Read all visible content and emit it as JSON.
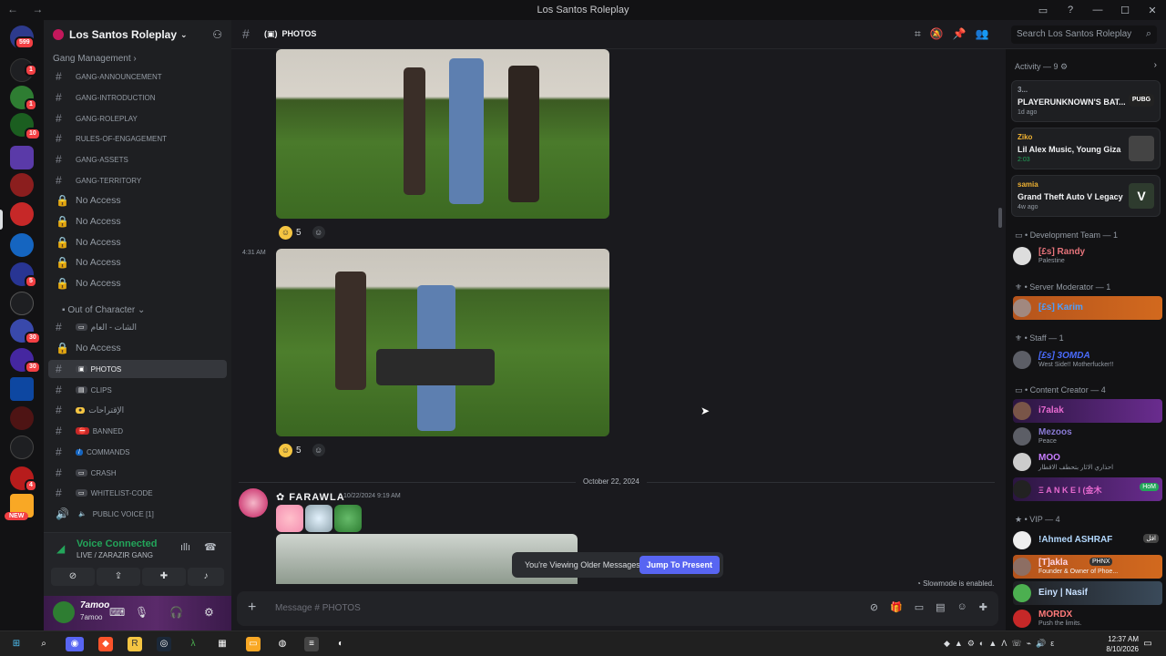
{
  "window": {
    "title": "Los Santos Roleplay",
    "nav": "← →"
  },
  "servers": {
    "badges": [
      "599",
      "1",
      "1",
      "10",
      "5",
      "30",
      "30",
      "4"
    ],
    "new_label": "NEW"
  },
  "guild": {
    "name": "Los Santos Roleplay"
  },
  "channels": {
    "category1": "Gang Management",
    "items": [
      {
        "label": "GANG-ANNOUNCEMENT"
      },
      {
        "label": "GANG-INTRODUCTION"
      },
      {
        "label": "GANG-ROLEPLAY"
      },
      {
        "label": "RULES-OF-ENGAGEMENT"
      },
      {
        "label": "GANG-ASSETS"
      },
      {
        "label": "GANG-TERRITORY"
      },
      {
        "label": "No Access"
      },
      {
        "label": "No Access"
      },
      {
        "label": "No Access"
      },
      {
        "label": "No Access"
      },
      {
        "label": "No Access"
      }
    ],
    "category2": "Out of Character",
    "ooc": [
      {
        "label": "الشات - العام"
      },
      {
        "label": "No Access"
      },
      {
        "label": "PHOTOS"
      },
      {
        "label": "CLIPS"
      },
      {
        "label": "الإقتراحات"
      },
      {
        "label": "BANNED"
      },
      {
        "label": "COMMANDS"
      },
      {
        "label": "CRASH"
      },
      {
        "label": "WHITELIST-CODE"
      },
      {
        "label": "PUBLIC VOICE [1]"
      }
    ]
  },
  "voice": {
    "title": "Voice Connected",
    "subtitle": "LIVE / ZARAZIR GANG"
  },
  "user": {
    "name": "7amoo",
    "status": "7amoo"
  },
  "header": {
    "channel": "PHOTOS",
    "search_placeholder": "Search Los Santos Roleplay"
  },
  "messages": {
    "timestamp": "4:31 AM",
    "reaction_count_1": "5",
    "reaction_count_2": "5",
    "divider_date": "October 22, 2024",
    "author": "FARAWLA",
    "author_time": "10/22/2024 9:19 AM"
  },
  "banner": {
    "text": "You're Viewing Older Messages",
    "button": "Jump To Present"
  },
  "slowmode": "Slowmode is enabled.",
  "composer": {
    "placeholder": "Message #  PHOTOS"
  },
  "activity": {
    "header": "Activity — 9",
    "cards": [
      {
        "user": "3...",
        "title": "PLAYERUNKNOWN'S BAT...",
        "sub": "1d ago",
        "art": "PUBG"
      },
      {
        "user": "Ziko",
        "title": "Lil Alex Music, Young Giza",
        "sub": "2:03",
        "art": ""
      },
      {
        "user": "samia",
        "title": "Grand Theft Auto V Legacy",
        "sub": "4w ago",
        "art": "V"
      }
    ],
    "roles": {
      "dev": "Development Team — 1",
      "mod": "Server Moderator — 1",
      "staff": "Staff — 1",
      "creator": "Content Creator — 4",
      "vip": "VIP — 4"
    },
    "members": [
      {
        "name": "[£s] Randy",
        "sub": "Palestine",
        "color": "#e5737a"
      },
      {
        "name": "[£s] Karim",
        "sub": "",
        "color": "#4a9eff"
      },
      {
        "name": "[£s] 3OMDA",
        "sub": "West Side!! Motherfucker!! ",
        "color": "#4a6cff"
      },
      {
        "name": "i7alak",
        "sub": "",
        "color": "#e86ad0"
      },
      {
        "name": "Mezoos",
        "sub": "Peace",
        "color": "#8a7bd6"
      },
      {
        "name": "MOO",
        "sub": "احذاري الاثار بتحطف الاقطار",
        "color": "#c77dff"
      },
      {
        "name": "Ξ A N K E I (金木",
        "sub": "",
        "color": "#e86ad0",
        "pill": "HoM"
      },
      {
        "name": "!Ahmed ASHRAF",
        "sub": "",
        "color": "#b3d9ff",
        "pill": "افل"
      },
      {
        "name": "[T]akla",
        "sub": "Founder & Owner of Phoe...",
        "color": "#ffb3d9",
        "pill": "PHNX"
      },
      {
        "name": "Einy | Nasif",
        "sub": "",
        "color": "#c7e0ff"
      },
      {
        "name": "MORDX",
        "sub": "Push the limits.",
        "color": "#ff7a7a"
      }
    ]
  },
  "taskbar": {
    "time": "12:37 AM",
    "date": "8/10/2026"
  },
  "colors": {
    "accent": "#5865f2",
    "online": "#23a55a",
    "danger": "#f23f43"
  }
}
